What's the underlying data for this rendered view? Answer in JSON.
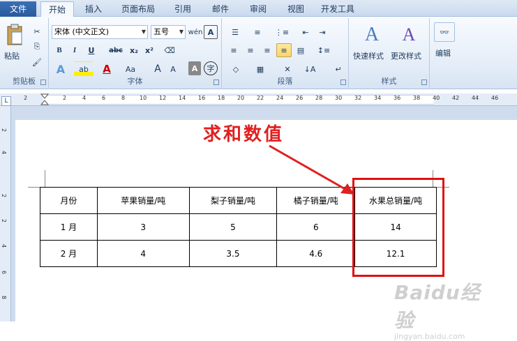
{
  "tabs": {
    "file": "文件",
    "items": [
      "开始",
      "插入",
      "页面布局",
      "引用",
      "邮件",
      "审阅",
      "视图",
      "开发工具"
    ]
  },
  "ribbon": {
    "clipboard": {
      "paste": "粘贴",
      "label": "剪贴板"
    },
    "font": {
      "name": "宋体 (中文正文)",
      "size": "五号",
      "label": "字体",
      "bold": "B",
      "italic": "I",
      "underline": "U",
      "strike": "abc",
      "sub": "x₂",
      "sup": "x²",
      "color_a": "A",
      "case": "Aa",
      "grow": "A",
      "shrink": "A"
    },
    "paragraph": {
      "label": "段落"
    },
    "styles": {
      "quick": "快速样式",
      "change": "更改样式",
      "label": "样式"
    },
    "edit": {
      "label": "编辑"
    }
  },
  "ruler": {
    "h_ticks": [
      "2",
      "2",
      "4",
      "6",
      "8",
      "10",
      "12",
      "14",
      "16",
      "18",
      "20",
      "22",
      "24",
      "26",
      "28",
      "30",
      "32",
      "34",
      "36",
      "38",
      "40",
      "42",
      "44",
      "46"
    ],
    "v_ticks": [
      "2",
      "4",
      "2",
      "2",
      "4",
      "6",
      "8"
    ]
  },
  "annotation": "求和数值",
  "table": {
    "headers": [
      "月份",
      "苹果销量/吨",
      "梨子销量/吨",
      "橘子销量/吨",
      "水果总销量/吨"
    ],
    "rows": [
      [
        "1 月",
        "3",
        "5",
        "6",
        "14"
      ],
      [
        "2 月",
        "4",
        "3.5",
        "4.6",
        "12.1"
      ]
    ]
  },
  "watermark": {
    "text": "Baidu经验",
    "url": "jingyan.baidu.com"
  },
  "colors": {
    "accent": "#2a5a9c",
    "annotation": "#e02020"
  }
}
